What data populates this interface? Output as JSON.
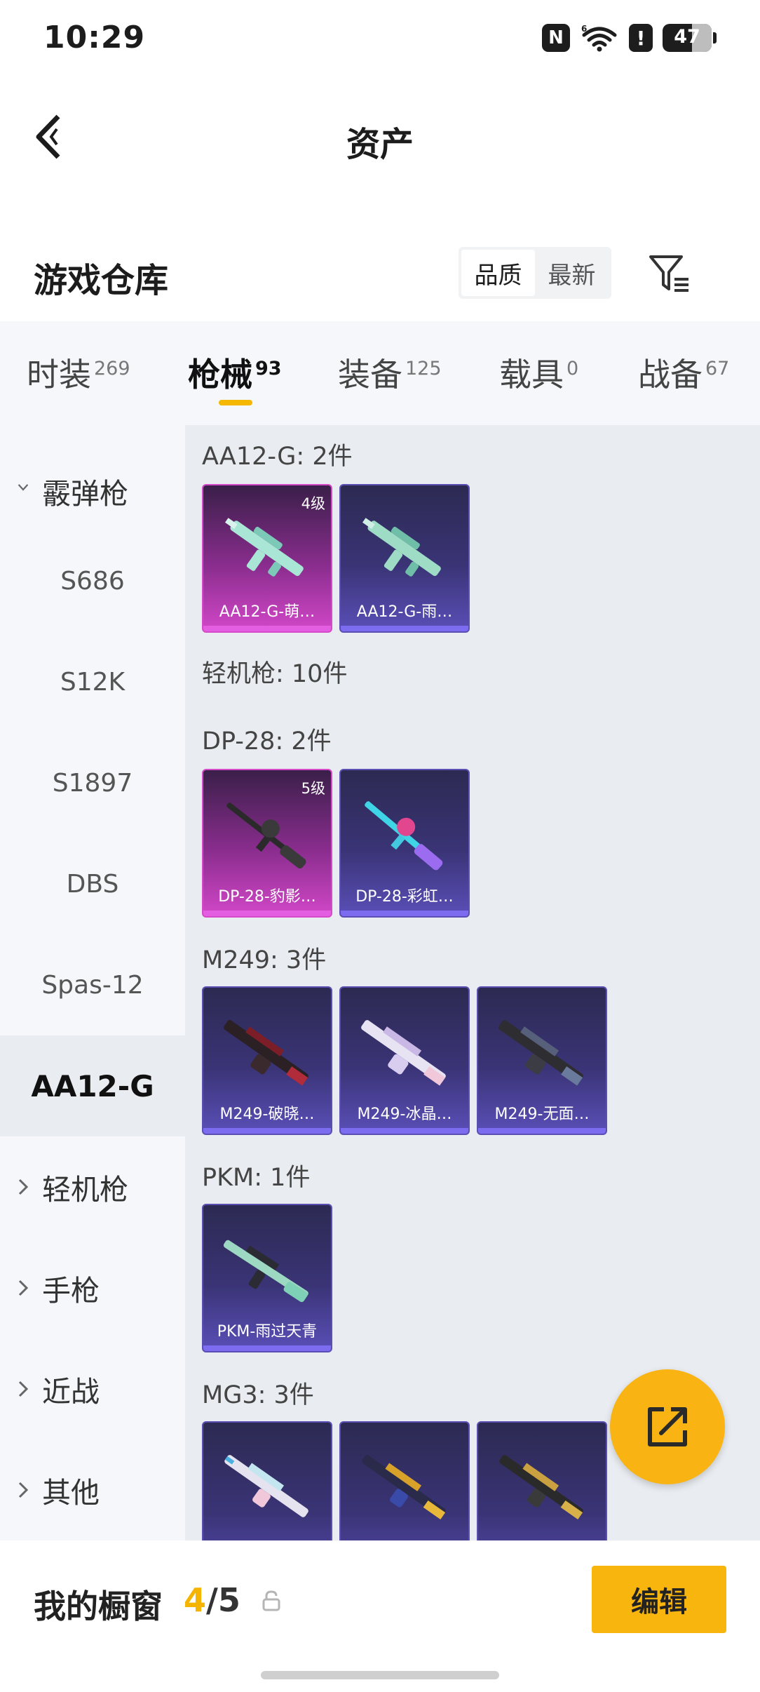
{
  "status_bar": {
    "time": "10:29",
    "battery": "47"
  },
  "header": {
    "title": "资产"
  },
  "warehouse": {
    "title": "游戏仓库",
    "sort_quality": "品质",
    "sort_newest": "最新"
  },
  "tabs": [
    {
      "label": "时装",
      "count": "269"
    },
    {
      "label": "枪械",
      "count": "93"
    },
    {
      "label": "装备",
      "count": "125"
    },
    {
      "label": "载具",
      "count": "0"
    },
    {
      "label": "战备",
      "count": "67"
    }
  ],
  "sidebar": {
    "group_shotgun": "霰弹枪",
    "items": [
      "S686",
      "S12K",
      "S1897",
      "DBS",
      "Spas-12",
      "AA12-G"
    ],
    "group_lmg": "轻机枪",
    "group_pistol": "手枪",
    "group_melee": "近战",
    "group_other": "其他"
  },
  "content": {
    "sections": [
      {
        "label": "AA12-G: 2件"
      },
      {
        "label": "轻机枪: 10件"
      },
      {
        "label": "DP-28: 2件"
      },
      {
        "label": "M249: 3件"
      },
      {
        "label": "PKM: 1件"
      },
      {
        "label": "MG3: 3件"
      }
    ],
    "cards": [
      {
        "name": "AA12-G-萌…",
        "level": "4级"
      },
      {
        "name": "AA12-G-雨…"
      },
      {
        "name": "DP-28-豹影…",
        "level": "5级"
      },
      {
        "name": "DP-28-彩虹…"
      },
      {
        "name": "M249-破晓…"
      },
      {
        "name": "M249-冰晶…"
      },
      {
        "name": "M249-无面…"
      },
      {
        "name": "PKM-雨过天青"
      }
    ]
  },
  "showcase": {
    "label": "我的橱窗",
    "current": "4",
    "separator": "/",
    "max": "5",
    "edit_label": "编辑"
  },
  "colors": {
    "accent": "#f7b50d",
    "purple_tier": "#3a3476",
    "magenta_tier": "#d247c8"
  }
}
